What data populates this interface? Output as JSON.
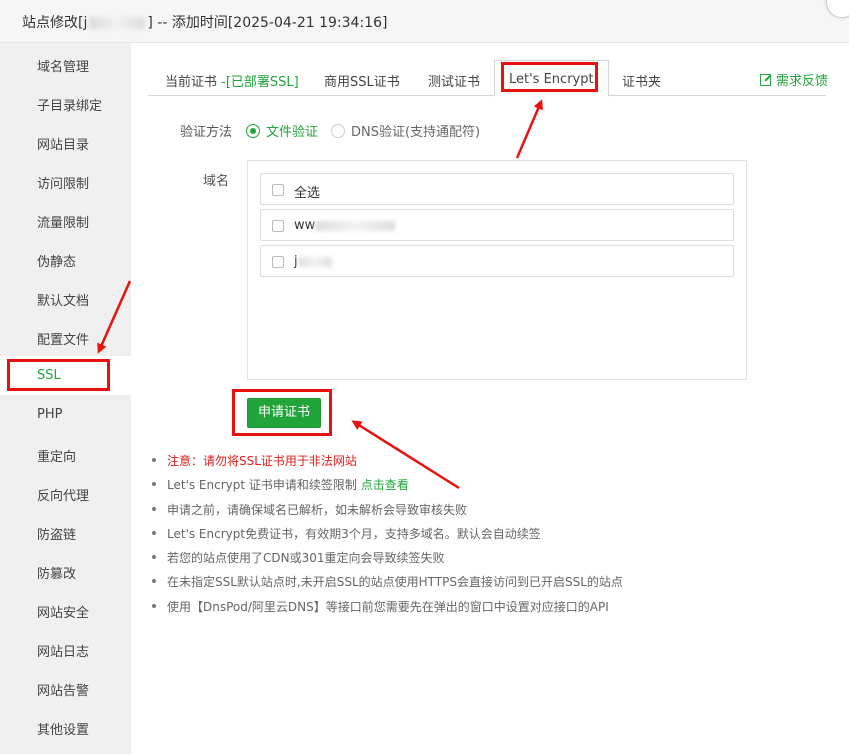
{
  "window": {
    "title_prefix": "站点修改[j",
    "title_suffix": "] -- 添加时间[2025-04-21 19:34:16]"
  },
  "sidebar": {
    "items": [
      {
        "label": "域名管理"
      },
      {
        "label": "子目录绑定"
      },
      {
        "label": "网站目录"
      },
      {
        "label": "访问限制"
      },
      {
        "label": "流量限制"
      },
      {
        "label": "伪静态"
      },
      {
        "label": "默认文档"
      },
      {
        "label": "配置文件"
      },
      {
        "label": "SSL",
        "active": true
      },
      {
        "label": "PHP"
      },
      {
        "label": "重定向"
      },
      {
        "label": "反向代理"
      },
      {
        "label": "防盗链"
      },
      {
        "label": "防篡改"
      },
      {
        "label": "网站安全"
      },
      {
        "label": "网站日志"
      },
      {
        "label": "网站告警"
      },
      {
        "label": "其他设置"
      }
    ]
  },
  "tabs": {
    "current_cert": "当前证书",
    "current_cert_status": "-[已部署SSL]",
    "commercial": "商用SSL证书",
    "test": "测试证书",
    "letsencrypt": "Let's Encrypt",
    "cert_folder": "证书夹",
    "feedback": "需求反馈"
  },
  "verify": {
    "label": "验证方法",
    "file_option": "文件验证",
    "dns_option": "DNS验证(支持通配符)",
    "selected": "file"
  },
  "domains": {
    "label": "域名",
    "select_all": "全选",
    "items": [
      {
        "prefix": "ww"
      },
      {
        "prefix": "j"
      }
    ]
  },
  "apply_button": "申请证书",
  "notes": [
    {
      "text": "注意：请勿将SSL证书用于非法网站",
      "warn": true
    },
    {
      "text": "Let's Encrypt 证书申请和续签限制 ",
      "link": "点击查看"
    },
    {
      "text": "申请之前，请确保域名已解析，如未解析会导致审核失败"
    },
    {
      "text": "Let's Encrypt免费证书，有效期3个月，支持多域名。默认会自动续签"
    },
    {
      "text": "若您的站点使用了CDN或301重定向会导致续签失败"
    },
    {
      "text": "在未指定SSL默认站点时,未开启SSL的站点使用HTTPS会直接访问到已开启SSL的站点"
    },
    {
      "text": "使用【DnsPod/阿里云DNS】等接口前您需要先在弹出的窗口中设置对应接口的API"
    }
  ],
  "colors": {
    "accent_green": "#20a53a",
    "annotation_red": "#e8110d",
    "warning_red": "#e11d1d"
  }
}
